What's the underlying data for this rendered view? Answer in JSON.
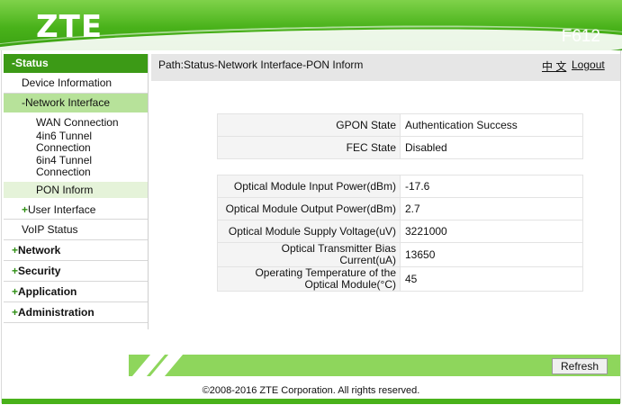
{
  "header": {
    "logo": "ZTE",
    "model": "F612"
  },
  "sidebar": {
    "status": "-Status",
    "device_information": "Device Information",
    "network_interface": "-Network Interface",
    "wan_connection": "WAN Connection",
    "tunnel_4in6_line1": "4in6 Tunnel",
    "tunnel_4in6_line2": "Connection",
    "tunnel_6in4_line1": "6in4 Tunnel",
    "tunnel_6in4_line2": "Connection",
    "pon_inform": "PON Inform",
    "user_interface_plus": "+",
    "user_interface": "User Interface",
    "voip_status": "VoIP Status",
    "network_plus": "+",
    "network": "Network",
    "security_plus": "+",
    "security": "Security",
    "application_plus": "+",
    "application": "Application",
    "administration_plus": "+",
    "administration": "Administration"
  },
  "pathbar": {
    "path": "Path:Status-Network Interface-PON Inform",
    "language": "中 文",
    "logout": "Logout"
  },
  "table1": [
    {
      "label": "GPON State",
      "value": "Authentication Success"
    },
    {
      "label": "FEC State",
      "value": "Disabled"
    }
  ],
  "table2": [
    {
      "label": "Optical Module Input Power(dBm)",
      "value": "-17.6"
    },
    {
      "label": "Optical Module Output Power(dBm)",
      "value": "2.7"
    },
    {
      "label": "Optical Module Supply Voltage(uV)",
      "value": "3221000"
    },
    {
      "label_line1": "Optical Transmitter Bias",
      "label_line2": "Current(uA)",
      "value": "13650"
    },
    {
      "label_line1": "Operating Temperature of the",
      "label_line2": "Optical Module(°C)",
      "value": "45"
    }
  ],
  "buttons": {
    "refresh": "Refresh"
  },
  "footer": {
    "copyright": "©2008-2016 ZTE Corporation. All rights reserved."
  },
  "colors": {
    "brand_green": "#49b21a",
    "active_menu": "#3c9a16",
    "submenu_highlight": "#b7e29a"
  }
}
